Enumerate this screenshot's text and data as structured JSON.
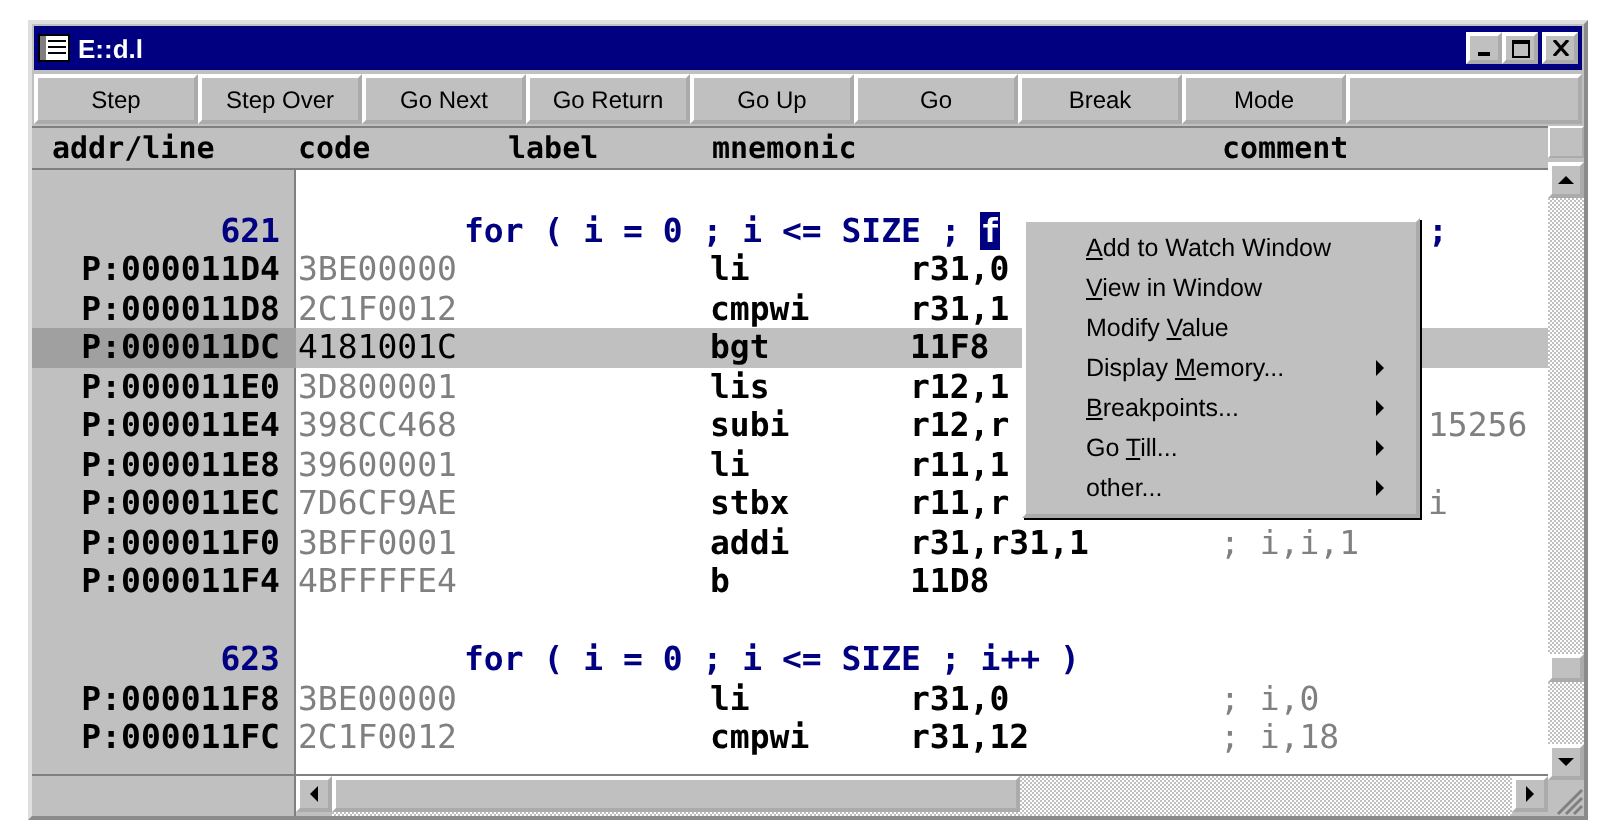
{
  "window": {
    "title": "E::d.l"
  },
  "toolbar": [
    "Step",
    "Step Over",
    "Go Next",
    "Go Return",
    "Go Up",
    "Go",
    "Break",
    "Mode"
  ],
  "columns": [
    "addr/line",
    "code",
    "label",
    "mnemonic",
    "comment"
  ],
  "rows": [
    {
      "kind": "source",
      "line": "621",
      "source": "for ( i = 0 ; i <= SIZE ; ",
      "selection": "f",
      "comment_past_menu": ";",
      "selected": false
    },
    {
      "kind": "asm",
      "addr": "P:000011D4",
      "code": "3BE00000",
      "mnemonic": "li",
      "operand": "r31,0",
      "selected": false
    },
    {
      "kind": "asm",
      "addr": "P:000011D8",
      "code": "2C1F0012",
      "mnemonic": "cmpwi",
      "operand": "r31,1",
      "selected": false
    },
    {
      "kind": "asm",
      "addr": "P:000011DC",
      "code": "4181001C",
      "mnemonic": "bgt",
      "operand": "11F8",
      "selected": true
    },
    {
      "kind": "asm",
      "addr": "P:000011E0",
      "code": "3D800001",
      "mnemonic": "lis",
      "operand": "r12,1",
      "selected": false
    },
    {
      "kind": "asm",
      "addr": "P:000011E4",
      "code": "398CC468",
      "mnemonic": "subi",
      "operand": "r12,r",
      "comment_past_menu": "15256",
      "selected": false
    },
    {
      "kind": "asm",
      "addr": "P:000011E8",
      "code": "39600001",
      "mnemonic": "li",
      "operand": "r11,1",
      "selected": false
    },
    {
      "kind": "asm",
      "addr": "P:000011EC",
      "code": "7D6CF9AE",
      "mnemonic": "stbx",
      "operand": "r11,r",
      "comment_past_menu": "i",
      "selected": false
    },
    {
      "kind": "asm",
      "addr": "P:000011F0",
      "code": "3BFF0001",
      "mnemonic": "addi",
      "operand": "r31,r31,1",
      "comment": "; i,i,1",
      "selected": false
    },
    {
      "kind": "asm",
      "addr": "P:000011F4",
      "code": "4BFFFFE4",
      "mnemonic": "b",
      "operand": "11D8",
      "selected": false
    },
    {
      "kind": "source",
      "line": "623",
      "source": "for ( i = 0 ; i <= SIZE ; i++ )",
      "selected": false
    },
    {
      "kind": "asm",
      "addr": "P:000011F8",
      "code": "3BE00000",
      "mnemonic": "li",
      "operand": "r31,0",
      "comment": "; i,0",
      "selected": false
    },
    {
      "kind": "asm",
      "addr": "P:000011FC",
      "code": "2C1F0012",
      "mnemonic": "cmpwi",
      "operand": "r31,12",
      "comment": "; i,18",
      "selected": false
    }
  ],
  "context_menu": [
    {
      "label": {
        "key": "A",
        "after": "dd to Watch Window"
      },
      "submenu": false
    },
    {
      "label": {
        "key": "V",
        "after": "iew in Window"
      },
      "submenu": false
    },
    {
      "label": {
        "before": "Modify ",
        "key": "V",
        "after": "alue"
      },
      "submenu": false
    },
    {
      "label": {
        "before": "Display ",
        "key": "M",
        "after": "emory..."
      },
      "submenu": true
    },
    {
      "label": {
        "key": "B",
        "after": "reakpoints..."
      },
      "submenu": true
    },
    {
      "label": {
        "before": "Go ",
        "key": "T",
        "after": "ill..."
      },
      "submenu": true
    },
    {
      "label": {
        "before": "other..."
      },
      "submenu": true
    }
  ]
}
